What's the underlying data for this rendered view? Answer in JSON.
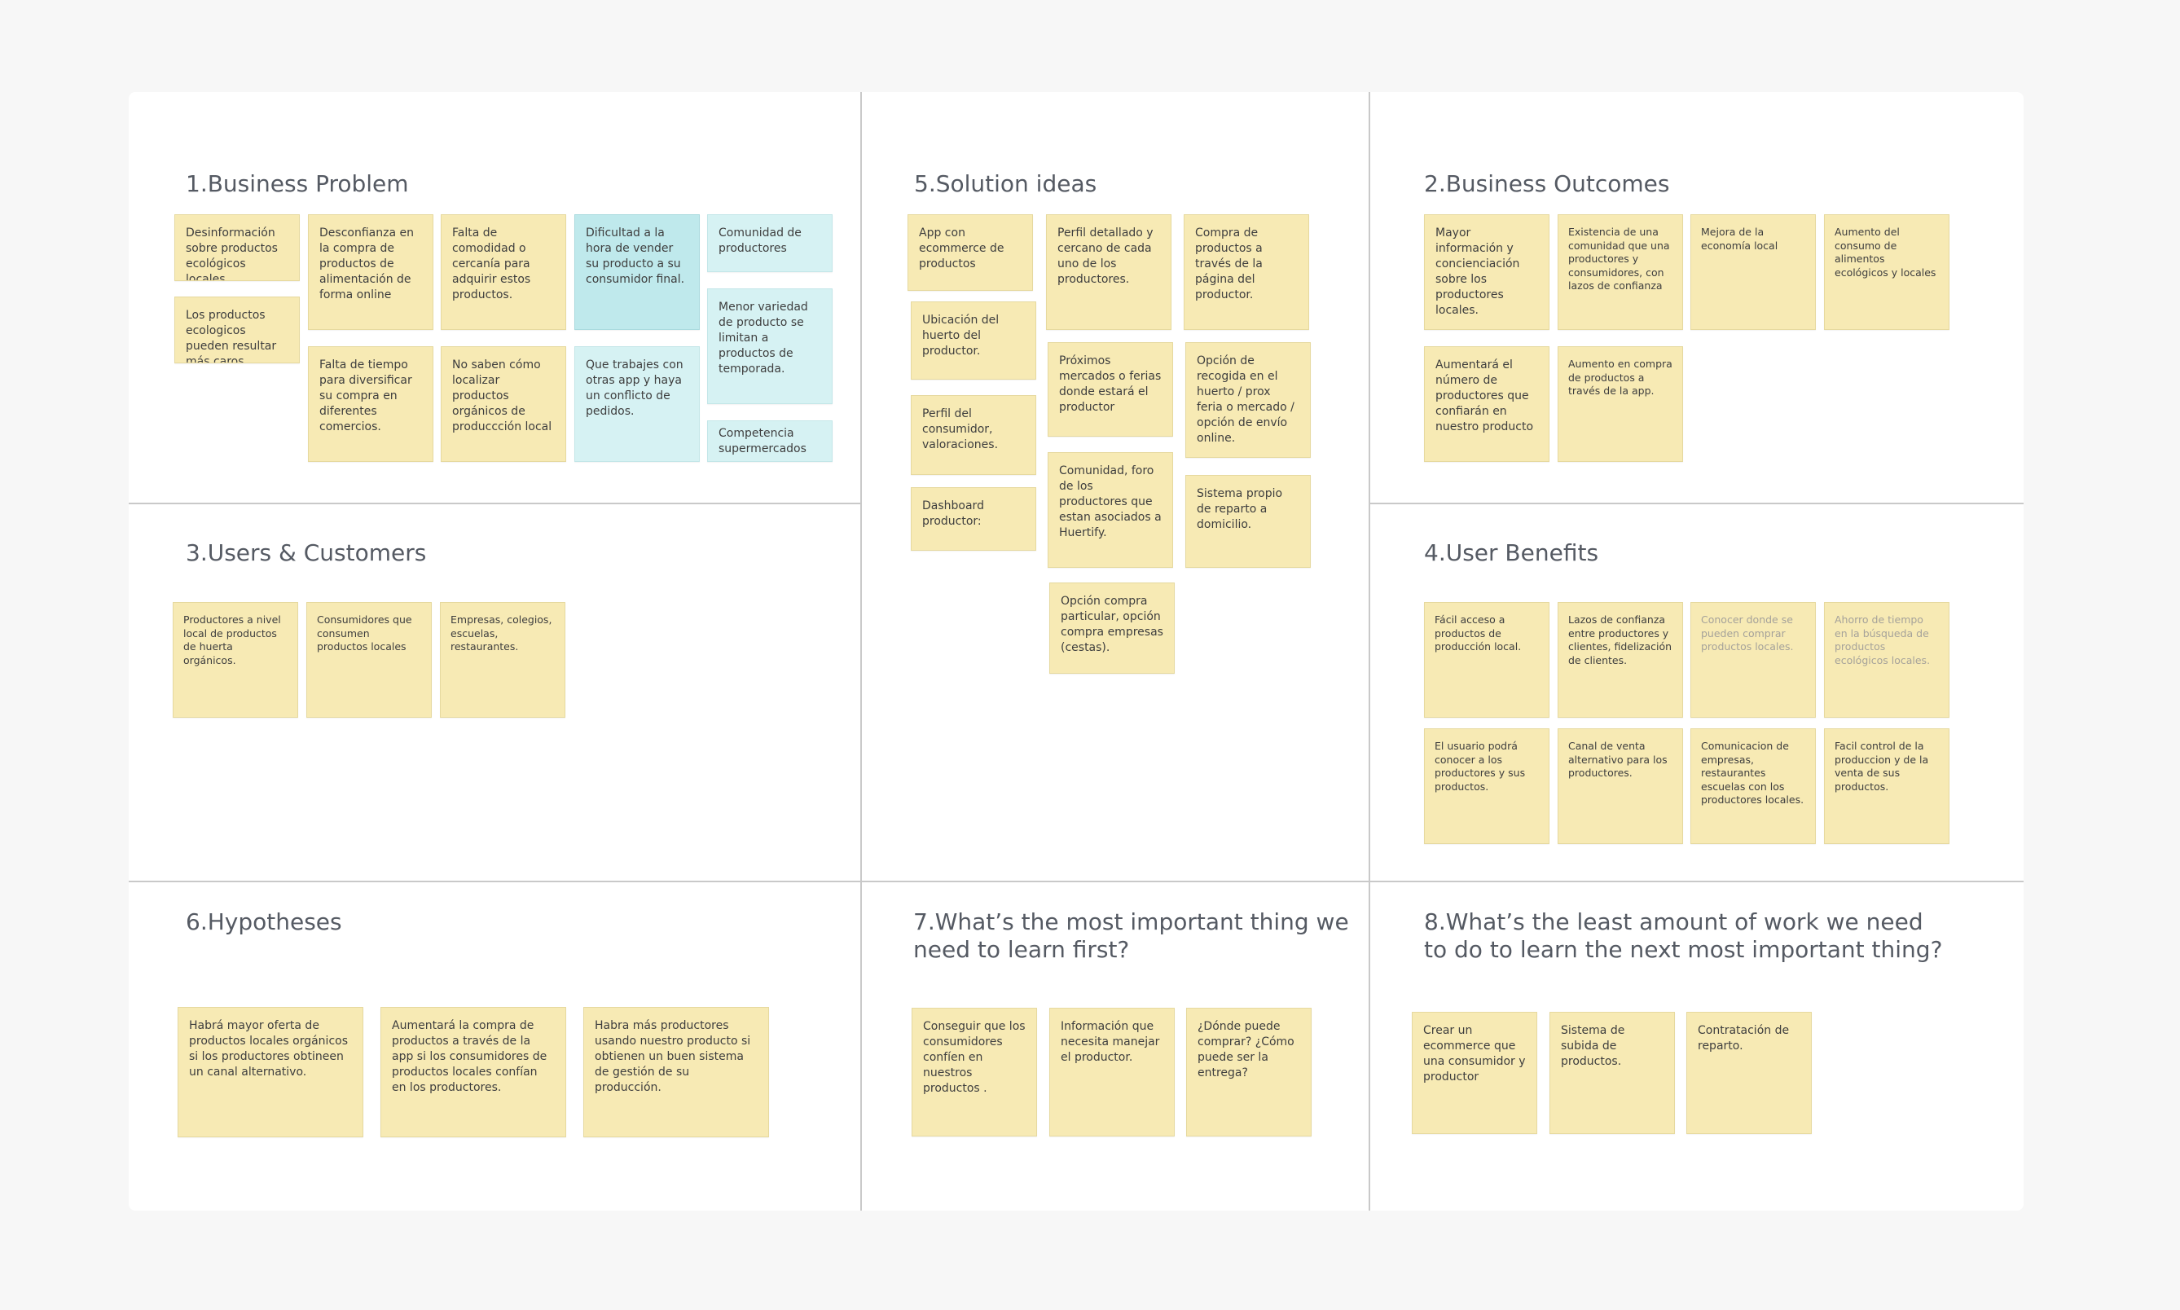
{
  "colors": {
    "background": "#f7f7f7",
    "board": "#ffffff",
    "note_yellow": "#f7eab4",
    "note_blue": "#d6f2f3",
    "note_teal": "#bfe9ec",
    "title_text": "#555a63",
    "grid_line": "#c9c9c9"
  },
  "sections": {
    "business_problem": {
      "title": "1.Business Problem",
      "notes": [
        "Desinformación sobre productos ecológicos locales",
        "Los productos ecologicos pueden resultar más caros.",
        "Desconfianza en la compra de productos de alimentación de forma online",
        "Falta de comodidad o cercanía para adquirir estos productos.",
        "Dificultad a la hora de vender su producto a su consumidor final.",
        "Comunidad de productores",
        "Menor variedad de producto se limitan a productos de temporada.",
        "Falta de tiempo para diversificar su compra en diferentes comercios.",
        "No saben cómo localizar productos orgánicos de produccción local",
        "Que trabajes con otras app y haya un conflicto de pedidos.",
        "Competencia supermercados"
      ]
    },
    "solution_ideas": {
      "title": "5.Solution ideas",
      "notes": [
        "App con ecommerce de productos",
        "Ubicación del huerto del productor.",
        "Perfil del consumidor, valoraciones.",
        "Dashboard productor:",
        "Perfil detallado y cercano de cada uno de los productores.",
        "Próximos mercados o ferias donde estará el productor",
        "Comunidad, foro de los productores que estan asociados a Huertify.",
        "Opción compra particular, opción compra empresas (cestas).",
        "Compra de productos a través de la página del productor.",
        "Opción de recogida en el huerto / prox feria o mercado / opción de envío online.",
        "Sistema propio de reparto a domicilio."
      ]
    },
    "business_outcomes": {
      "title": "2.Business Outcomes",
      "notes": [
        "Mayor información y concienciación sobre los productores locales.",
        "Existencia de una comunidad que una productores y consumidores, con lazos de confianza",
        "Mejora de la economía local",
        "Aumento del consumo de alimentos ecológicos y locales",
        "Aumentará el número de productores que confiarán en nuestro producto",
        "Aumento en compra de productos a través de la app."
      ]
    },
    "users_customers": {
      "title": "3.Users & Customers",
      "notes": [
        "Productores a nivel local de productos de huerta orgánicos.",
        "Consumidores que consumen productos locales",
        "Empresas, colegios, escuelas, restaurantes."
      ]
    },
    "user_benefits": {
      "title": "4.User Benefits",
      "notes": [
        "Fácil acceso a productos de producción local.",
        "Lazos de confianza entre productores y clientes, fidelización de clientes.",
        "Conocer donde se pueden comprar productos locales.",
        "Ahorro de tiempo en la búsqueda de productos ecológicos locales.",
        "El usuario podrá conocer a los productores y sus productos.",
        "Canal de venta alternativo para los productores.",
        "Comunicacion de empresas, restaurantes escuelas con los productores locales.",
        "Facil control de la produccion y de la venta de sus productos."
      ]
    },
    "hypotheses": {
      "title": "6.Hypotheses",
      "notes": [
        "Habrá mayor oferta de productos locales orgánicos si los productores obtineen un canal alternativo.",
        "Aumentará la compra de productos a través de la app si los consumidores de productos locales confían en los productores.",
        "Habra más productores usando nuestro producto si obtienen un buen sistema de gestión de su producción."
      ]
    },
    "learn_first": {
      "title_line1": "7.What’s the most important thing we",
      "title_line2": "need to learn first?",
      "notes": [
        "Conseguir que los consumidores confíen en nuestros productos .",
        "Información que necesita manejar el productor.",
        "¿Dónde puede comprar? ¿Cómo puede ser la entrega?"
      ]
    },
    "least_work": {
      "title_line1": "8.What’s the least amount of work we need",
      "title_line2": "to do to learn the next most important thing?",
      "notes": [
        "Crear un ecommerce que una consumidor y productor",
        "Sistema de subida de productos.",
        "Contratación de reparto."
      ]
    }
  }
}
